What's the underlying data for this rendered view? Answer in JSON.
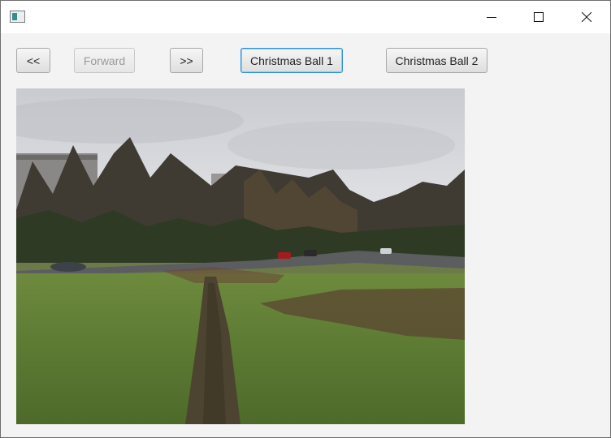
{
  "window": {
    "title": "",
    "controls": [
      "minimize-icon",
      "maximize-icon",
      "close-icon"
    ]
  },
  "toolbar": {
    "back_label": "<<",
    "forward_label": "Forward",
    "next_label": ">>",
    "ball1_label": "Christmas Ball 1",
    "ball2_label": "Christmas Ball 2"
  },
  "image": {
    "subject": "grassy-field-with-path-trees-road",
    "colors": {
      "sky": "#d9dbe0",
      "grass": "#5f7a35",
      "path": "#4e4633",
      "trees": "#3c3a33"
    }
  }
}
